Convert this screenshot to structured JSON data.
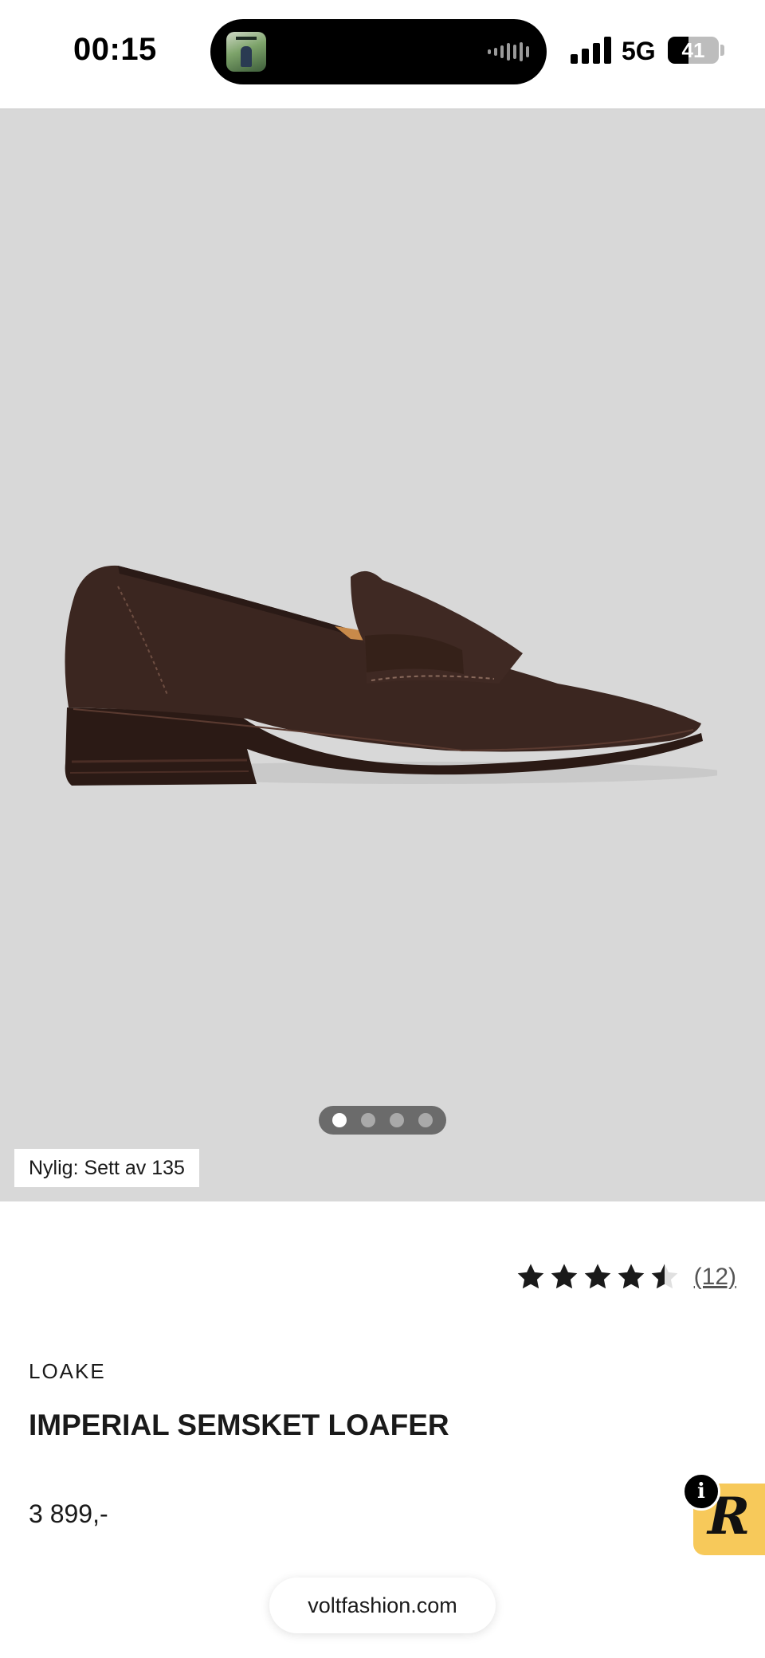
{
  "status_bar": {
    "time": "00:15",
    "network": "5G",
    "battery_level": "41",
    "battery_fraction": 0.41
  },
  "product": {
    "recently_viewed": "Nylig: Sett av 135",
    "carousel": {
      "total": 4,
      "active_index": 0
    },
    "rating": {
      "stars": 4.5,
      "max": 5,
      "review_count": "(12)"
    },
    "brand": "LOAKE",
    "name": "IMPERIAL SEMSKET LOAFER",
    "price": "3 899,-"
  },
  "widget": {
    "letter": "R",
    "info": "i"
  },
  "browser": {
    "url": "voltfashion.com"
  },
  "colors": {
    "image_background": "#d8d8d8",
    "shoe": "#3b2620",
    "widget": "#f7c95a",
    "star": "#1a1a1a"
  }
}
